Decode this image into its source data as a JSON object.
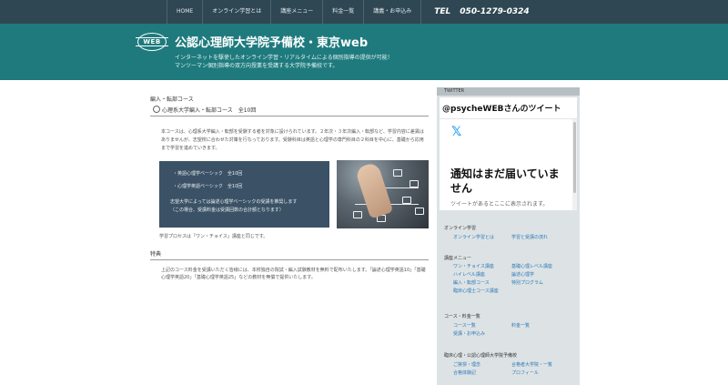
{
  "nav": {
    "items": [
      "HOME",
      "オンライン学習とは",
      "講座メニュー",
      "料金一覧",
      "講義・お申込み"
    ],
    "tel_label": "TEL",
    "tel_number": "050-1279-0324"
  },
  "header": {
    "logo_text": "WEB",
    "title": "公認心理師大学院予備校・東京web",
    "tagline_1": "インターネットを駆使したオンライン学習・リアルタイムによる個別指導の提供が可能！",
    "tagline_2": "マンツーマン個別指導の双方向授業を受講する大学院予備校です。"
  },
  "main": {
    "breadcrumb": "編入・転部コース",
    "section_title": "心理系大学編入・転部コース　全10回",
    "intro": "本コースは、心理系大学編入・転部を受験する者を対象に設けられています。２年次・３年次編入・転部など、学習内容に差異はありませんが、志望校に合わせた対策を行なっております。受験科目は英語と心理学の専門科目の２科目を中心に、基礎から応用まで学習を進めていきます。",
    "box": {
      "bullet_1": "・英語心理学ベーシック　全10回",
      "bullet_2": "・心理学英語ベーシック　全10回",
      "note_1": "志望大学によっては論述心理学ベーシックの受講を推奨します",
      "note_2": "（この場合、受講料金は受講回数の合計額となります）"
    },
    "course_text": "学習プロセスは「ワン・チョイス」講座と同じです。",
    "subhead": "特典",
    "note": "上記のコース料金を受講いただく皆様には、本校独自の院試・編入試験教材を無料で配布いたします。「論述心理学英語10」「基礎心理学英語20」「基礎心理学英語25」などの教材を無償で提供いたします。"
  },
  "sidebar": {
    "twitter_head": "TWITTER",
    "tw_title": "@psycheWEBさんのツイート",
    "tw_logo": "𝕏",
    "tw_msg": "通知はまだ届いていません",
    "tw_sub": "ツイートがあるとここに表示されます。",
    "sec1": "オンライン学習",
    "sec1_items": [
      [
        "オンライン学習とは",
        "学習と受講の流れ"
      ]
    ],
    "sec2": "講座メニュー",
    "sec2_items": [
      [
        "ワン・チョイス講座",
        "基礎心理レベル講座"
      ],
      [
        "ハイレベル講座",
        "論述心理学"
      ],
      [
        "編入・転部コース",
        "特別プログラム"
      ],
      [
        "臨床心理士コース講座",
        ""
      ]
    ],
    "sec3": "コース・料金一覧",
    "sec3_items": [
      [
        "コース一覧",
        "料金一覧"
      ],
      [
        "受講・お申込み",
        ""
      ]
    ],
    "sec4": "臨床心理・公認心理師大学院予備校",
    "sec4_items": [
      [
        "ご挨拶・理念",
        "合格者大学院・一覧"
      ],
      [
        "合格体験記",
        "プロフィール"
      ]
    ]
  },
  "colors": {
    "nav_bg": "#2f4753",
    "header_bg": "#1e7a7d",
    "box_bg": "#3b5266",
    "sidebar_bg": "#dde3e5",
    "link": "#2f79b7"
  }
}
